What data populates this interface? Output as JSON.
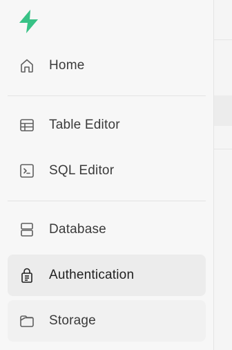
{
  "sidebar": {
    "logo_icon": "supabase-bolt-icon",
    "brand_color": "#3ecf8e",
    "items": [
      {
        "label": "Home",
        "icon": "home-icon"
      },
      {
        "label": "Table Editor",
        "icon": "table-icon"
      },
      {
        "label": "SQL Editor",
        "icon": "terminal-icon"
      },
      {
        "label": "Database",
        "icon": "database-icon"
      },
      {
        "label": "Authentication",
        "icon": "lock-icon",
        "active": true
      },
      {
        "label": "Storage",
        "icon": "folder-icon"
      }
    ]
  }
}
